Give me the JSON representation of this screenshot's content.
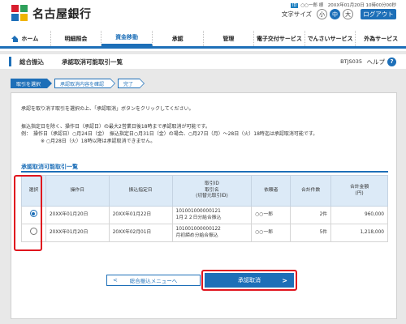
{
  "brand": {
    "name": "名古屋銀行",
    "colors": {
      "red": "#d81e2e",
      "blue": "#1d6fb8",
      "green": "#2ea05a",
      "yellow": "#f0b400"
    }
  },
  "header": {
    "user_id_badge": "ID",
    "user_text": "○○一郎 様　20XX年01月20日 10時00分00秒",
    "font_size_label": "文字サイズ",
    "font_sizes": [
      "小",
      "中",
      "大"
    ],
    "font_size_selected": "中",
    "logout_label": "ログアウト"
  },
  "nav": {
    "items": [
      "ホーム",
      "明細照会",
      "資金移動",
      "承認",
      "管理",
      "電子交付サービス",
      "でんさいサービス",
      "外為サービス"
    ],
    "active": "資金移動"
  },
  "title_bar": {
    "main": "総合振込",
    "sub": "承認取消可能取引一覧",
    "screen_id": "BTJS035",
    "help_label": "ヘルプ",
    "help_icon": "?"
  },
  "steps": [
    {
      "label": "取引を選択",
      "active": true
    },
    {
      "label": "承認取消内容を確認",
      "active": false
    },
    {
      "label": "完了",
      "active": false
    }
  ],
  "messages": {
    "line1": "承認を取り消す取引を選択の上、「承認取消」ボタンをクリックしてください。",
    "line2": "振込指定日を除く、操作日（承認日）の最大2営業日後18時まで承認取消が可能です。",
    "line3": "例：　操作日（承認日）○月24日（金）　振込指定日○月31日（金）の場合、○月27日（月）～28日（火）18時迄は承認取消可能です。",
    "line4": "※ ○月28日（火）18時以降は承認取消できません。"
  },
  "section": {
    "title": "承認取消可能取引一覧"
  },
  "table": {
    "headers": {
      "select": "選択",
      "op_date": "操作日",
      "transfer_date": "振込指定日",
      "txn_id": "取引ID",
      "txn_name": "取引名",
      "txn_note": "(切替元取引ID)",
      "requester": "依頼者",
      "count": "合計件数",
      "amount": "合計金額",
      "amount_unit": "(円)"
    },
    "rows": [
      {
        "selected": true,
        "op_date": "20XX年01月20日",
        "transfer_date": "20XX年01月22日",
        "txn_id": "101001000000121",
        "txn_name": "1月２２日分給合振込",
        "requester": "○○一郎",
        "count": "2件",
        "amount": "960,000"
      },
      {
        "selected": false,
        "op_date": "20XX年01月20日",
        "transfer_date": "20XX年02月01日",
        "txn_id": "101001000000122",
        "txn_name": "月初締め分給合振込",
        "requester": "○○一郎",
        "count": "5件",
        "amount": "1,218,000"
      }
    ]
  },
  "buttons": {
    "back_label": "総合振込メニューへ",
    "approve_cancel_label": "承認取消",
    "left_chevron": "<",
    "right_chevron": ">"
  }
}
